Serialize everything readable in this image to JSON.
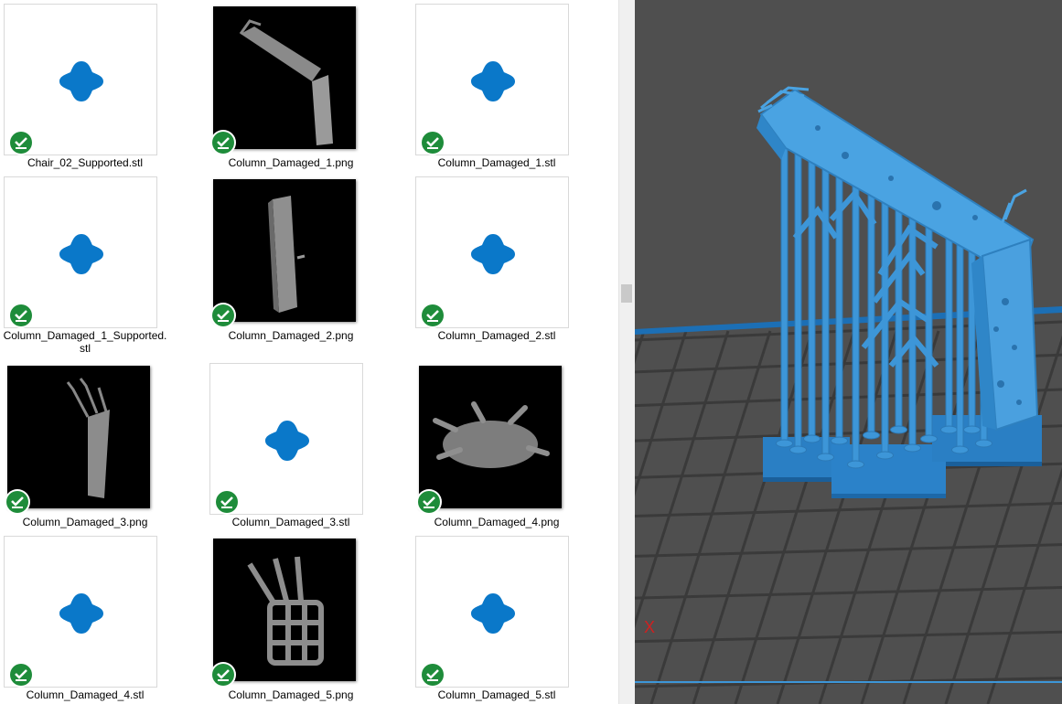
{
  "files": [
    {
      "name": "Chair_02_Supported.stl",
      "kind": "stl"
    },
    {
      "name": "Column_Damaged_1.png",
      "kind": "png",
      "preview": "column-bent"
    },
    {
      "name": "Column_Damaged_1.stl",
      "kind": "stl"
    },
    {
      "name": "Column_Damaged_1_Supported.stl",
      "kind": "stl"
    },
    {
      "name": "Column_Damaged_2.png",
      "kind": "png",
      "preview": "column-tall"
    },
    {
      "name": "Column_Damaged_2.stl",
      "kind": "stl"
    },
    {
      "name": "Column_Damaged_3.png",
      "kind": "png",
      "preview": "column-rebar"
    },
    {
      "name": "Column_Damaged_3.stl",
      "kind": "stl"
    },
    {
      "name": "Column_Damaged_4.png",
      "kind": "png",
      "preview": "rubble-hand"
    },
    {
      "name": "Column_Damaged_4.stl",
      "kind": "stl"
    },
    {
      "name": "Column_Damaged_5.png",
      "kind": "png",
      "preview": "cage-hand"
    },
    {
      "name": "Column_Damaged_5.stl",
      "kind": "stl"
    }
  ],
  "icons": {
    "stl_icon": "3d-model-file-icon",
    "sync_badge": "green-check-sync-icon"
  },
  "viewport": {
    "axis_label": "X"
  },
  "colors": {
    "stl_icon": "#0a78c9",
    "badge": "#1e8c3a",
    "model": "#3d96d8",
    "viewport_bg": "#4f4f4f",
    "grid_line": "#3a3a3a",
    "axis_x": "#d02020",
    "bed_edge": "#1c6fb5"
  }
}
